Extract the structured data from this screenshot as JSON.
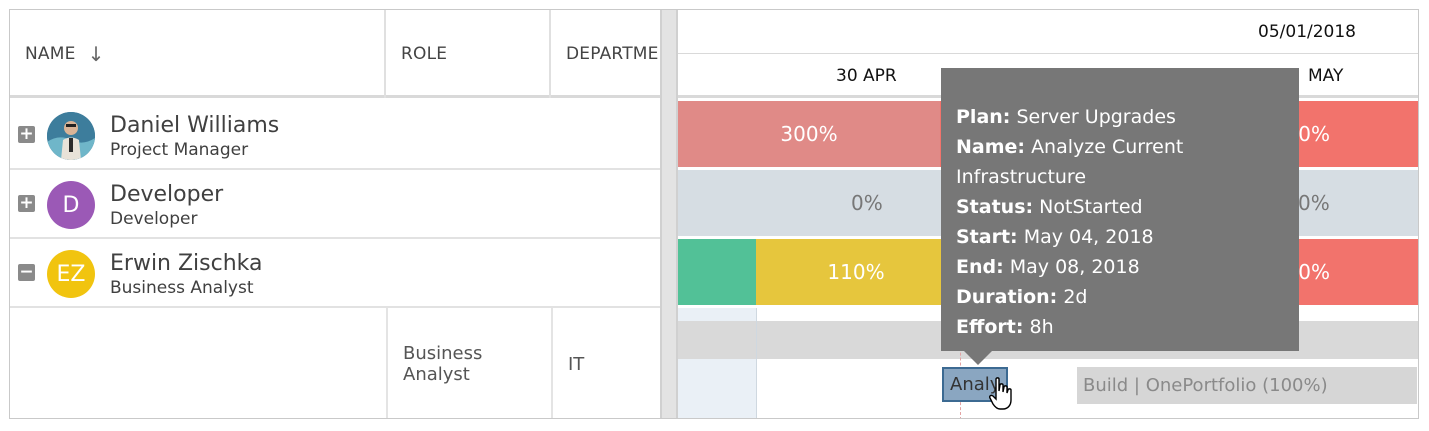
{
  "columns": {
    "name": "NAME",
    "name_sort_icon": "arrow-down-icon",
    "role": "ROLE",
    "department": "DEPARTME"
  },
  "resources": [
    {
      "name": "Daniel Williams",
      "role": "Project Manager",
      "toggle": "+",
      "avatar_initials": "",
      "avatar_color": "#4a7fa0"
    },
    {
      "name": "Developer",
      "role": "Developer",
      "toggle": "+",
      "avatar_initials": "D",
      "avatar_color": "#9b59b6"
    },
    {
      "name": "Erwin Zischka",
      "role": "Business Analyst",
      "toggle": "−",
      "avatar_initials": "EZ",
      "avatar_color": "#f1c40f"
    }
  ],
  "assignment_row": {
    "role": "Business Analyst",
    "department": "IT"
  },
  "timeline": {
    "date_header": "05/01/2018",
    "days": [
      "30 APR",
      "MAY"
    ],
    "rows": [
      {
        "cells": [
          "300%",
          "20%"
        ],
        "colors": [
          "#e08a87",
          "#f2736c"
        ]
      },
      {
        "cells": [
          "0%",
          "0%"
        ],
        "colors": [
          "#d6dde3",
          "#d6dde3"
        ]
      },
      {
        "cells": [
          "110%",
          "00%"
        ],
        "colors": [
          "#e6c63d",
          "#f2736c"
        ],
        "lead_color": "#52c197"
      }
    ],
    "task_short_label": "Analy",
    "task_bar_label": "Build | OnePortfolio (100%)"
  },
  "tooltip": {
    "plan_label": "Plan:",
    "plan_value": "Server Upgrades",
    "name_label": "Name:",
    "name_value": "Analyze Current Infrastructure",
    "status_label": "Status:",
    "status_value": "NotStarted",
    "start_label": "Start:",
    "start_value": "May 04, 2018",
    "end_label": "End:",
    "end_value": "May 08, 2018",
    "duration_label": "Duration:",
    "duration_value": "2d",
    "effort_label": "Effort:",
    "effort_value": "8h"
  },
  "colors": {
    "over_allocated": "#f2736c",
    "under_allocated": "#e6c63d",
    "available": "#52c197",
    "tooltip_bg": "#777777"
  }
}
